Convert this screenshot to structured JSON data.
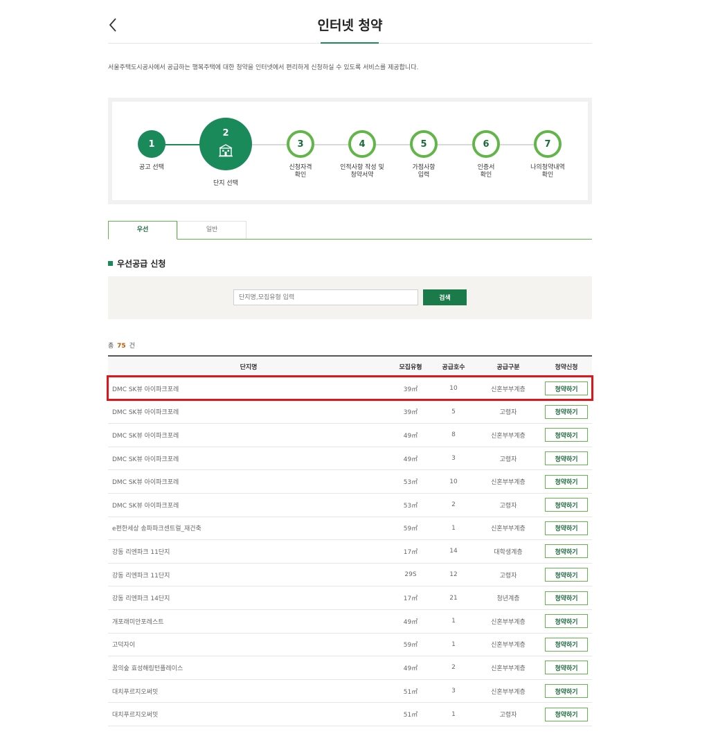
{
  "header": {
    "title": "인터넷 청약",
    "back_icon": "chevron-left-icon"
  },
  "intro": "서울주택도시공사에서 공급하는 행복주택에 대한 청약을 인터넷에서 편리하게 신청하실 수 있도록 서비스를 제공합니다.",
  "steps": [
    {
      "num": "1",
      "label": "공고 선택",
      "state": "done"
    },
    {
      "num": "2",
      "label": "단지 선택",
      "state": "current",
      "icon": "building-icon"
    },
    {
      "num": "3",
      "label": "신청자격\n확인",
      "state": "todo"
    },
    {
      "num": "4",
      "label": "인적사항 작성 및\n청약서약",
      "state": "todo"
    },
    {
      "num": "5",
      "label": "가점사항\n입력",
      "state": "todo"
    },
    {
      "num": "6",
      "label": "인증서\n확인",
      "state": "todo"
    },
    {
      "num": "7",
      "label": "나의청약내역\n확인",
      "state": "todo"
    }
  ],
  "tabs": [
    {
      "label": "우선",
      "active": true
    },
    {
      "label": "일반",
      "active": false
    }
  ],
  "section_title": "우선공급 신청",
  "search": {
    "placeholder": "단지명,모집유형 입력",
    "button": "검색"
  },
  "count": {
    "prefix": "총",
    "value": "75",
    "suffix": "건"
  },
  "table": {
    "headers": [
      "단지명",
      "모집유형",
      "공급호수",
      "공급구분",
      "청약신청"
    ],
    "rows": [
      {
        "name": "DMC SK뷰 아이파크포레",
        "type": "39㎡",
        "units": "10",
        "kind": "신혼부부계층",
        "action": "청약하기"
      },
      {
        "name": "DMC SK뷰 아이파크포레",
        "type": "39㎡",
        "units": "5",
        "kind": "고령자",
        "action": "청약하기"
      },
      {
        "name": "DMC SK뷰 아이파크포레",
        "type": "49㎡",
        "units": "8",
        "kind": "신혼부부계층",
        "action": "청약하기"
      },
      {
        "name": "DMC SK뷰 아이파크포레",
        "type": "49㎡",
        "units": "3",
        "kind": "고령자",
        "action": "청약하기"
      },
      {
        "name": "DMC SK뷰 아이파크포레",
        "type": "53㎡",
        "units": "10",
        "kind": "신혼부부계층",
        "action": "청약하기"
      },
      {
        "name": "DMC SK뷰 아이파크포레",
        "type": "53㎡",
        "units": "2",
        "kind": "고령자",
        "action": "청약하기"
      },
      {
        "name": "e편한세상 송파파크센트럴_재건축",
        "type": "59㎡",
        "units": "1",
        "kind": "신혼부부계층",
        "action": "청약하기"
      },
      {
        "name": "강동 리엔파크 11단지",
        "type": "17㎡",
        "units": "14",
        "kind": "대학생계층",
        "action": "청약하기"
      },
      {
        "name": "강동 리엔파크 11단지",
        "type": "29S",
        "units": "12",
        "kind": "고령자",
        "action": "청약하기"
      },
      {
        "name": "강동 리엔파크 14단지",
        "type": "17㎡",
        "units": "21",
        "kind": "청년계층",
        "action": "청약하기"
      },
      {
        "name": "개포래미안포레스트",
        "type": "49㎡",
        "units": "1",
        "kind": "신혼부부계층",
        "action": "청약하기"
      },
      {
        "name": "고덕자이",
        "type": "59㎡",
        "units": "1",
        "kind": "신혼부부계층",
        "action": "청약하기"
      },
      {
        "name": "꿈의숲 효성해링턴플레이스",
        "type": "49㎡",
        "units": "2",
        "kind": "신혼부부계층",
        "action": "청약하기"
      },
      {
        "name": "대치푸르지오써밋",
        "type": "51㎡",
        "units": "3",
        "kind": "신혼부부계층",
        "action": "청약하기"
      },
      {
        "name": "대치푸르지오써밋",
        "type": "51㎡",
        "units": "1",
        "kind": "고령자",
        "action": "청약하기"
      }
    ]
  },
  "colors": {
    "primary": "#1a8a5a",
    "accent_green": "#62b548",
    "highlight_red": "#e0141a"
  }
}
